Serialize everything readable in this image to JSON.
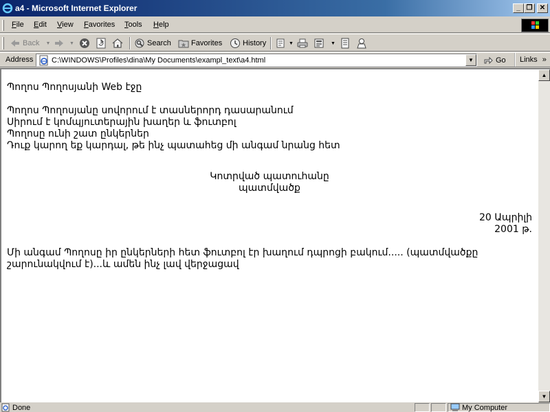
{
  "window": {
    "title": "a4 - Microsoft Internet Explorer",
    "minimize": "_",
    "maximize": "❐",
    "close": "✕"
  },
  "menu": {
    "items": [
      "File",
      "Edit",
      "View",
      "Favorites",
      "Tools",
      "Help"
    ]
  },
  "toolbar": {
    "back": "Back",
    "search": "Search",
    "favorites": "Favorites",
    "history": "History"
  },
  "address": {
    "label": "Address",
    "value": "C:\\WINDOWS\\Profiles\\dina\\My Documents\\exampl_text\\a4.html",
    "go": "Go",
    "links": "Links"
  },
  "page": {
    "heading": "Պողոս Պողոսյանի Web էջը",
    "lines": [
      "Պողոս Պողոսյանը սովորում է տասներորդ դասարանում",
      "Սիրում է կոմպյուտերային խաղեր և ֆուտբոլ",
      "Պողոսը ունի շատ ընկերներ",
      "Դուք կարող եք կարդալ, թե ինչ պատահեց մի անգամ նրանց հետ"
    ],
    "center_title": "Կոտրված պատուհանը",
    "center_subtitle": "պատմվածք",
    "date_line1": "20 Ապրիլի",
    "date_line2": "2001 թ.",
    "story_line1": "Մի անգամ Պողոսը իր ընկերների հետ ֆուտբոլ էր խաղում դպրոցի բակում..... (պատմվածքը",
    "story_line2": "շարունակվում է)...և ամեն ինչ լավ վերջացավ"
  },
  "status": {
    "text": "Done",
    "zone": "My Computer"
  },
  "colors": {
    "titlebar_start": "#0a246a",
    "chrome": "#d4d0c8"
  }
}
